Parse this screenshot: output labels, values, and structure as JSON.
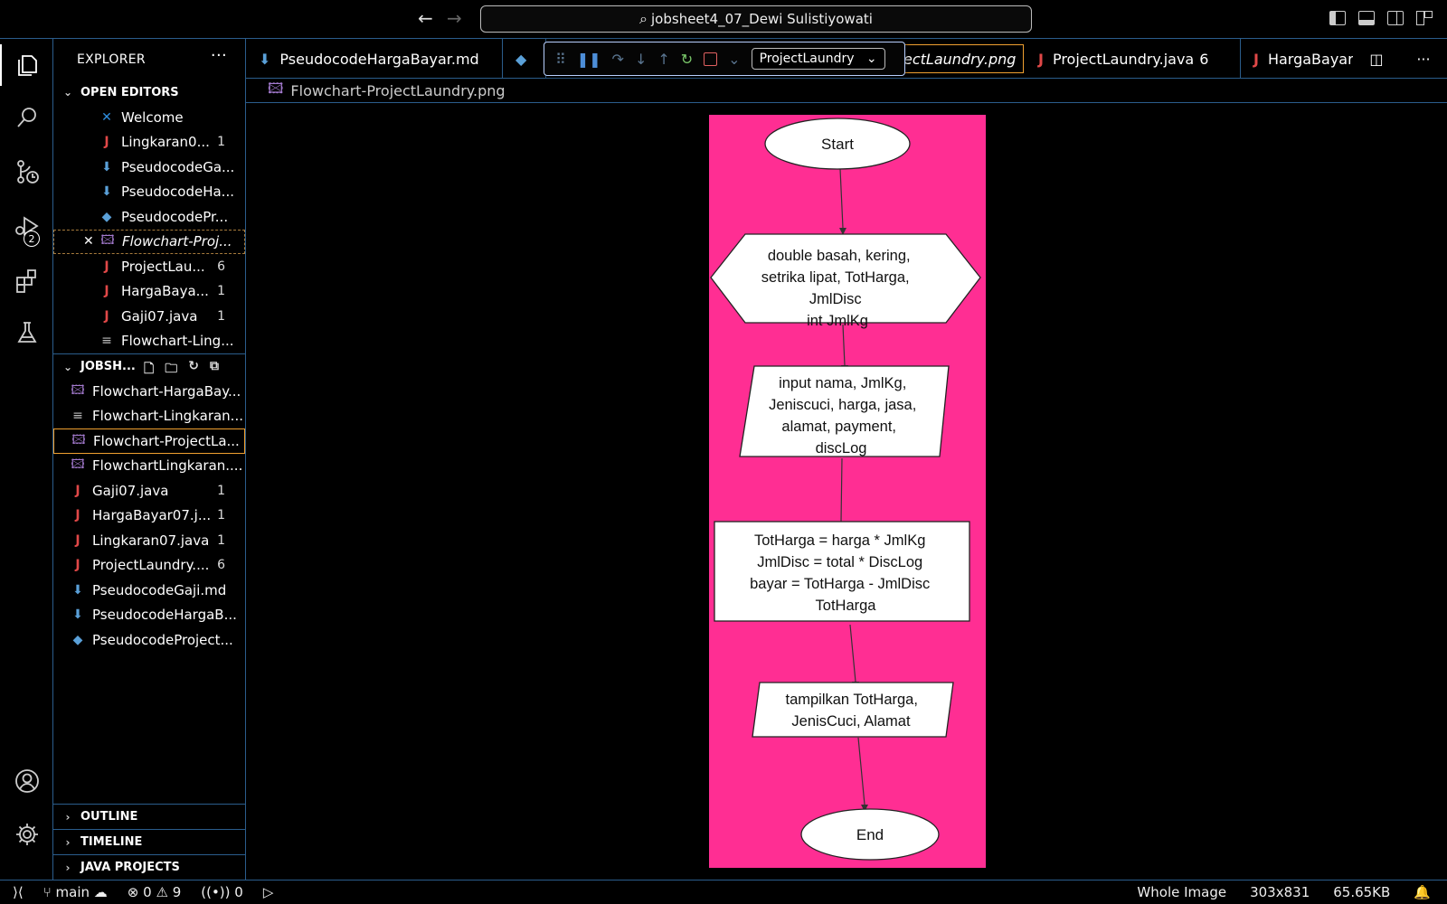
{
  "titlebar": {
    "search_text": "jobsheet4_07_Dewi Sulistiyowati"
  },
  "activity": {
    "debug_badge": "2"
  },
  "sidebar": {
    "title": "EXPLORER",
    "open_editors_label": "OPEN EDITORS",
    "open_editors": [
      {
        "name": "Welcome",
        "icon": "vscode-icon",
        "count": ""
      },
      {
        "name": "Lingkaran0...",
        "icon": "java-icon",
        "count": "1"
      },
      {
        "name": "PseudocodeGa...",
        "icon": "markdown-icon",
        "count": ""
      },
      {
        "name": "PseudocodeHa...",
        "icon": "markdown-icon",
        "count": ""
      },
      {
        "name": "PseudocodePr...",
        "icon": "python-icon",
        "count": ""
      },
      {
        "name": "Flowchart-Proj...",
        "icon": "image-icon",
        "count": ""
      },
      {
        "name": "ProjectLau...",
        "icon": "java-icon",
        "count": "6"
      },
      {
        "name": "HargaBaya...",
        "icon": "java-icon",
        "count": "1"
      },
      {
        "name": "Gaji07.java",
        "icon": "java-icon",
        "count": "1"
      },
      {
        "name": "Flowchart-Ling...",
        "icon": "text-icon",
        "count": ""
      }
    ],
    "workspace_label": "JOBSH...",
    "workspace_files": [
      {
        "name": "Flowchart-HargaBay...",
        "icon": "image-icon",
        "count": ""
      },
      {
        "name": "Flowchart-Lingkaran...",
        "icon": "text-icon",
        "count": ""
      },
      {
        "name": "Flowchart-ProjectLa...",
        "icon": "image-icon",
        "count": ""
      },
      {
        "name": "FlowchartLingkaran....",
        "icon": "image-icon",
        "count": ""
      },
      {
        "name": "Gaji07.java",
        "icon": "java-icon",
        "count": "1"
      },
      {
        "name": "HargaBayar07.j...",
        "icon": "java-icon",
        "count": "1"
      },
      {
        "name": "Lingkaran07.java",
        "icon": "java-icon",
        "count": "1"
      },
      {
        "name": "ProjectLaundry....",
        "icon": "java-icon",
        "count": "6"
      },
      {
        "name": "PseudocodeGaji.md",
        "icon": "markdown-icon",
        "count": ""
      },
      {
        "name": "PseudocodeHargaB...",
        "icon": "markdown-icon",
        "count": ""
      },
      {
        "name": "PseudocodeProject...",
        "icon": "python-icon",
        "count": ""
      }
    ],
    "outline_label": "OUTLINE",
    "timeline_label": "TIMELINE",
    "java_projects_label": "JAVA PROJECTS"
  },
  "tabs": [
    {
      "label": "PseudocodeHargaBayar.md",
      "icon": "markdown-icon",
      "count": ""
    },
    {
      "label": "ectLaundry.png",
      "icon": "image-icon",
      "count": "",
      "active": true
    },
    {
      "label": "ProjectLaundry.java",
      "icon": "java-icon",
      "count": "6"
    },
    {
      "label": "HargaBayar",
      "icon": "java-icon",
      "count": ""
    }
  ],
  "debug": {
    "config": "ProjectLaundry"
  },
  "breadcrumb": "Flowchart-ProjectLaundry.png",
  "flowchart": {
    "start": "Start",
    "declare": [
      "double basah, kering,",
      "setrika lipat, TotHarga,",
      "JmlDisc",
      "int JmlKg"
    ],
    "input": [
      "input nama, JmlKg,",
      "Jeniscuci, harga, jasa,",
      "alamat, payment,",
      "discLog"
    ],
    "process": [
      "TotHarga = harga * JmlKg",
      "JmlDisc = total * DiscLog",
      "bayar = TotHarga - JmlDisc",
      "TotHarga"
    ],
    "output": [
      "tampilkan TotHarga,",
      "JenisCuci, Alamat"
    ],
    "end": "End",
    "background": "#ff2e93"
  },
  "status": {
    "branch": "main",
    "errors": "0",
    "warnings": "9",
    "ports": "0",
    "view": "Whole Image",
    "dimensions": "303x831",
    "size": "65.65KB"
  }
}
